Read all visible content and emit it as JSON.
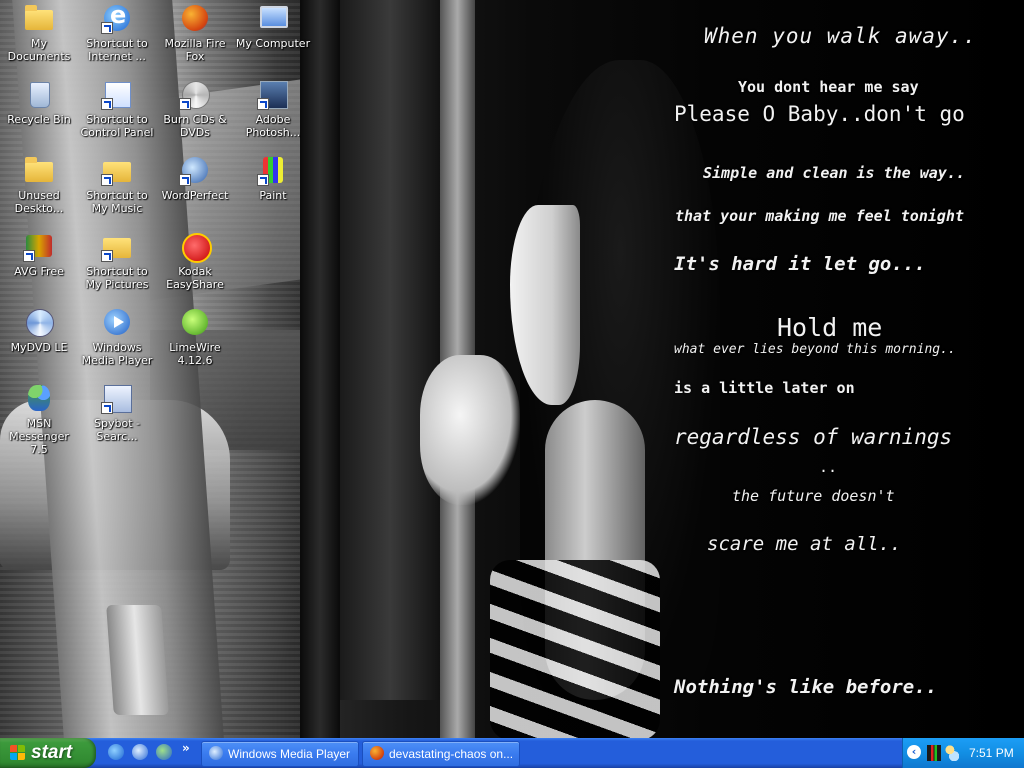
{
  "desktop": {
    "icons": [
      {
        "label": "My Documents",
        "icon": "folder-documents-icon"
      },
      {
        "label": "Shortcut to Internet ...",
        "icon": "internet-explorer-icon"
      },
      {
        "label": "Mozilla Fire Fox",
        "icon": "firefox-icon"
      },
      {
        "label": "My Computer",
        "icon": "my-computer-icon"
      },
      {
        "label": "Recycle Bin",
        "icon": "recycle-bin-icon"
      },
      {
        "label": "Shortcut to Control Panel",
        "icon": "control-panel-icon"
      },
      {
        "label": "Burn CDs & DVDs",
        "icon": "burn-cd-icon"
      },
      {
        "label": "Adobe Photosh...",
        "icon": "photoshop-icon"
      },
      {
        "label": "Unused Deskto...",
        "icon": "folder-icon"
      },
      {
        "label": "Shortcut to My Music",
        "icon": "music-folder-icon"
      },
      {
        "label": "WordPerfect",
        "icon": "wordperfect-icon"
      },
      {
        "label": "Paint",
        "icon": "paint-icon"
      },
      {
        "label": "AVG Free",
        "icon": "avg-antivirus-icon"
      },
      {
        "label": "Shortcut to My Pictures",
        "icon": "pictures-folder-icon"
      },
      {
        "label": "Kodak EasyShare",
        "icon": "kodak-icon"
      },
      {
        "label": "MyDVD LE",
        "icon": "mydvd-icon"
      },
      {
        "label": "Windows Media Player",
        "icon": "windows-media-player-icon"
      },
      {
        "label": "LimeWire 4.12.6",
        "icon": "limewire-icon"
      },
      {
        "label": "MSN Messenger 7.5",
        "icon": "msn-messenger-icon"
      },
      {
        "label": "Spybot - Searc...",
        "icon": "spybot-icon"
      }
    ]
  },
  "wallpaper": {
    "lyrics": [
      "When you walk away..",
      "You dont hear me say",
      "Please O Baby..don't go",
      "Simple and clean is the way..",
      "that your making me feel tonight",
      "It's hard it let go...",
      "Hold me",
      "what ever lies beyond this morning..",
      "is a little later on",
      "regardless of warnings",
      "..",
      "the future doesn't",
      "scare me at all..",
      "Nothing's like before.."
    ]
  },
  "taskbar": {
    "start_label": "start",
    "quick_launch": [
      "internet-explorer-icon",
      "windows-media-player-icon",
      "msn-messenger-icon"
    ],
    "quick_launch_more": "»",
    "tasks": [
      {
        "label": "Windows Media Player",
        "icon": "windows-media-player-icon"
      },
      {
        "label": "devastating-chaos on...",
        "icon": "firefox-icon"
      }
    ],
    "tray": {
      "expand": "‹",
      "icons": [
        "volume-meter-icon",
        "network-icon"
      ],
      "clock": "7:51 PM"
    }
  },
  "colors": {
    "taskbar_blue": "#245edb",
    "start_green": "#318a31",
    "tray_blue": "#128fe4"
  }
}
